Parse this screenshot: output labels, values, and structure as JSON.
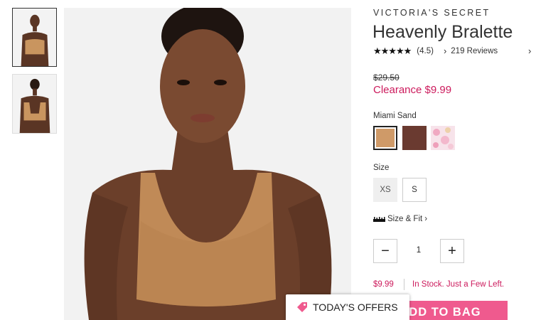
{
  "brand": "VICTORIA'S SECRET",
  "product": {
    "title": "Heavenly Bralette",
    "stars": "★★★★★",
    "rating": "(4.5)",
    "reviews": "219 Reviews",
    "original_price": "$29.50",
    "sale_price": "Clearance $9.99"
  },
  "color": {
    "label": "Miami Sand",
    "swatches": [
      {
        "name": "Miami Sand",
        "hex": "#cf9a68",
        "selected": true
      },
      {
        "name": "Brown",
        "hex": "#6a3a30",
        "selected": false
      },
      {
        "name": "Pink Print",
        "hex": "#f6dde6",
        "selected": false
      }
    ]
  },
  "size": {
    "label": "Size",
    "options": [
      "XS",
      "S"
    ],
    "size_fit_label": "Size & Fit"
  },
  "quantity": {
    "value": "1",
    "minus": "−",
    "plus": "+"
  },
  "summary": {
    "price": "$9.99",
    "stock": "In Stock. Just a Few Left."
  },
  "actions": {
    "add_to_bag": "ADD TO BAG",
    "offers": "TODAY'S OFFERS"
  },
  "colors": {
    "accent": "#cc1a5c",
    "button": "#ef5a8e"
  }
}
